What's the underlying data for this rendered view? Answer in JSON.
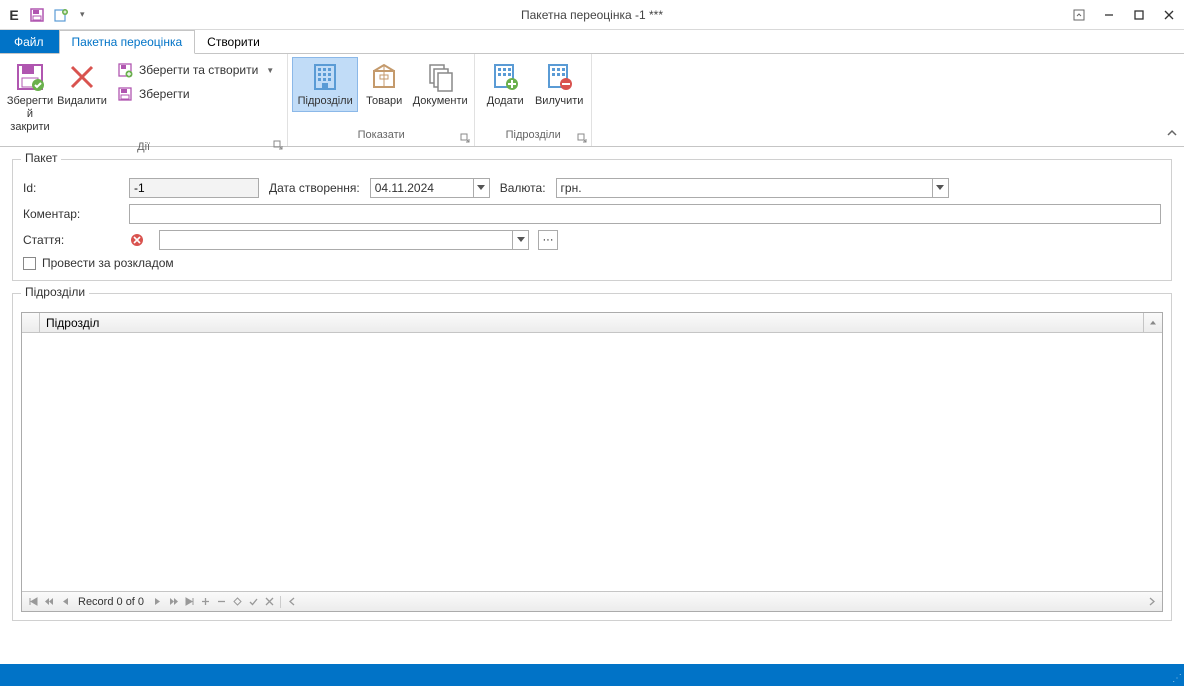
{
  "window": {
    "title": "Пакетна переоцінка -1 ***",
    "app_letter": "E"
  },
  "tabs": {
    "file": "Файл",
    "batch": "Пакетна переоцінка",
    "create": "Створити"
  },
  "ribbon": {
    "actions": {
      "label": "Дії",
      "save_close": "Зберегти й закрити",
      "delete": "Видалити",
      "save_create": "Зберегти та створити",
      "save": "Зберегти"
    },
    "show": {
      "label": "Показати",
      "units": "Підрозділи",
      "goods": "Товари",
      "docs": "Документи"
    },
    "units": {
      "label": "Підрозділи",
      "add": "Додати",
      "remove": "Вилучити"
    }
  },
  "form": {
    "packet_legend": "Пакет",
    "id_label": "Id:",
    "id_value": "-1",
    "date_label": "Дата створення:",
    "date_value": "04.11.2024",
    "currency_label": "Валюта:",
    "currency_value": "грн.",
    "comment_label": "Коментар:",
    "comment_value": "",
    "article_label": "Стаття:",
    "article_value": "",
    "schedule_label": "Провести за розкладом"
  },
  "grid": {
    "legend": "Підрозділи",
    "col_unit": "Підрозділ",
    "record_text": "Record 0 of 0"
  }
}
